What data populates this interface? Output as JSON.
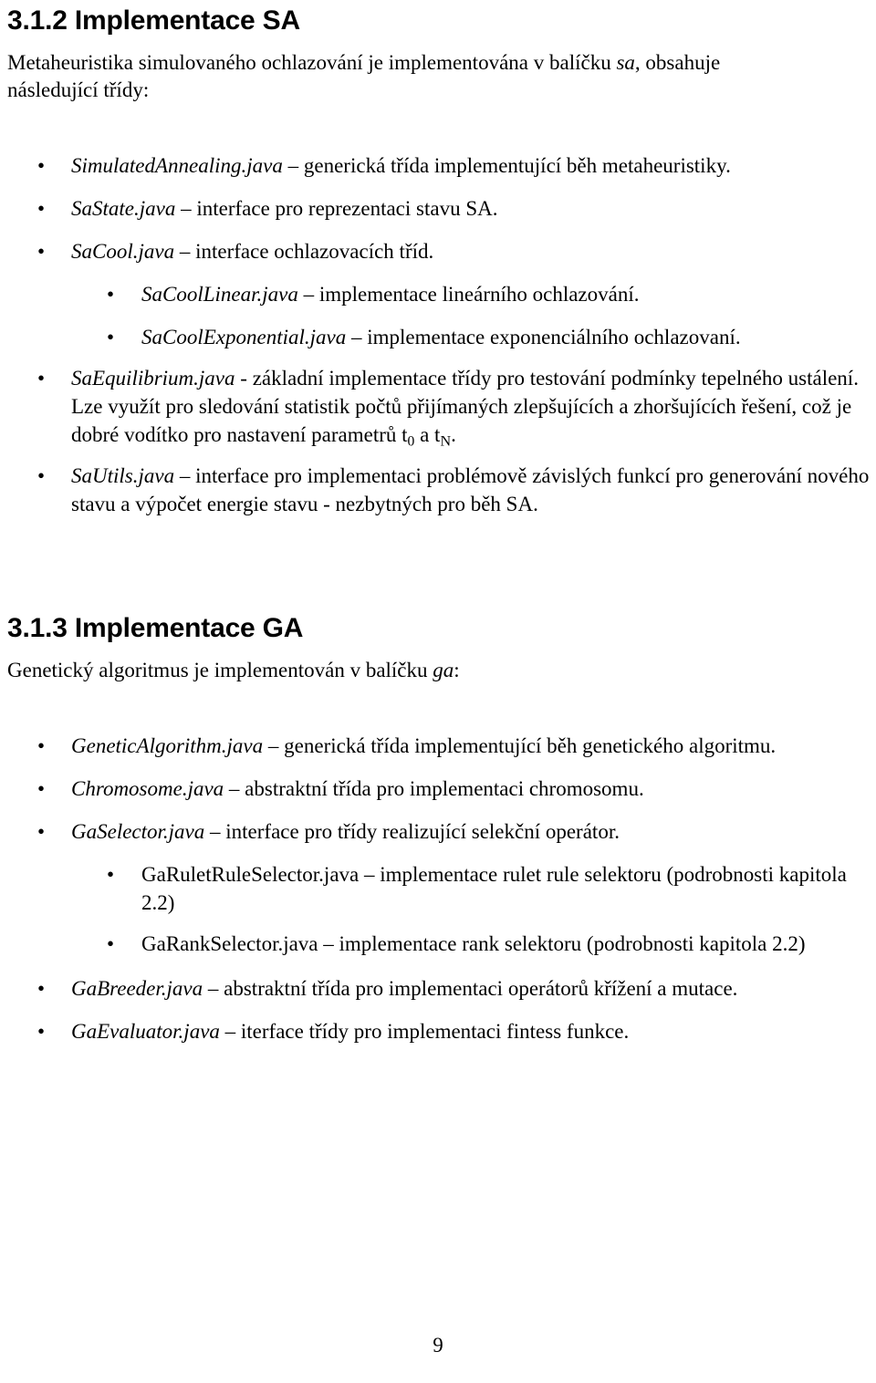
{
  "page": {
    "number": "9",
    "bullet_glyph": "•"
  },
  "sections": [
    {
      "id": "sa",
      "heading": "3.1.2 Implementace SA",
      "intro_line1_a": "Metaheuristika simulovaného ochlazování je implementována v balíčku ",
      "intro_line1_em": "sa",
      "intro_line1_b": ", obsahuje",
      "intro_line2": "následující třídy:",
      "items": [
        {
          "level": 1,
          "name": "SimulatedAnnealing.java",
          "rest": " – generická třída implementující běh metaheuristiky."
        },
        {
          "level": 1,
          "name": "SaState.java",
          "rest": " – interface pro reprezentaci stavu SA."
        },
        {
          "level": 1,
          "name": "SaCool.java",
          "rest": " – interface ochlazovacích tříd."
        },
        {
          "level": 2,
          "name": "SaCoolLinear.java",
          "rest": " – implementace lineárního ochlazování."
        },
        {
          "level": 2,
          "name": "SaCoolExponential.java",
          "rest": " – implementace exponenciálního ochlazovaní."
        },
        {
          "level": 1,
          "name": "SaEquilibrium.java",
          "rest": " - základní implementace třídy pro testování podmínky tepelného ustálení. Lze využít pro sledování statistik počtů přijímaných zlepšujících a zhoršujících řešení, což je dobré vodítko pro nastavení parametrů t",
          "sub1": "0",
          "mid": " a t",
          "sub2": "N",
          "tail": "."
        },
        {
          "level": 1,
          "name": "SaUtils.java",
          "rest": " – interface pro implementaci problémově závislých funkcí pro generování nového stavu a výpočet energie stavu - nezbytných pro běh SA."
        }
      ]
    },
    {
      "id": "ga",
      "heading": "3.1.3 Implementace GA",
      "intro_line1_a": "Genetický algoritmus je implementován v balíčku ",
      "intro_line1_em": "ga",
      "intro_line1_b": ":",
      "items": [
        {
          "level": 1,
          "name": "GeneticAlgorithm.java",
          "rest": " – generická třída implementující běh genetického algoritmu."
        },
        {
          "level": 1,
          "name": "Chromosome.java",
          "rest": " – abstraktní třída pro implementaci chromosomu."
        },
        {
          "level": 1,
          "name": "GaSelector.java",
          "rest": " – interface pro třídy realizující selekční operátor."
        },
        {
          "level": 2,
          "upright": true,
          "name": "GaRuletRuleSelector.java",
          "rest": " – implementace rulet rule selektoru (podrobnosti kapitola 2.2)"
        },
        {
          "level": 2,
          "upright": true,
          "name": "GaRankSelector.java",
          "rest": " – implementace rank selektoru (podrobnosti kapitola 2.2)"
        },
        {
          "level": 1,
          "name": "GaBreeder.java",
          "rest": " – abstraktní třída pro implementaci operátorů křížení a mutace."
        },
        {
          "level": 1,
          "name": "GaEvaluator.java",
          "rest": " – iterface třídy pro implementaci fintess funkce."
        }
      ]
    }
  ]
}
